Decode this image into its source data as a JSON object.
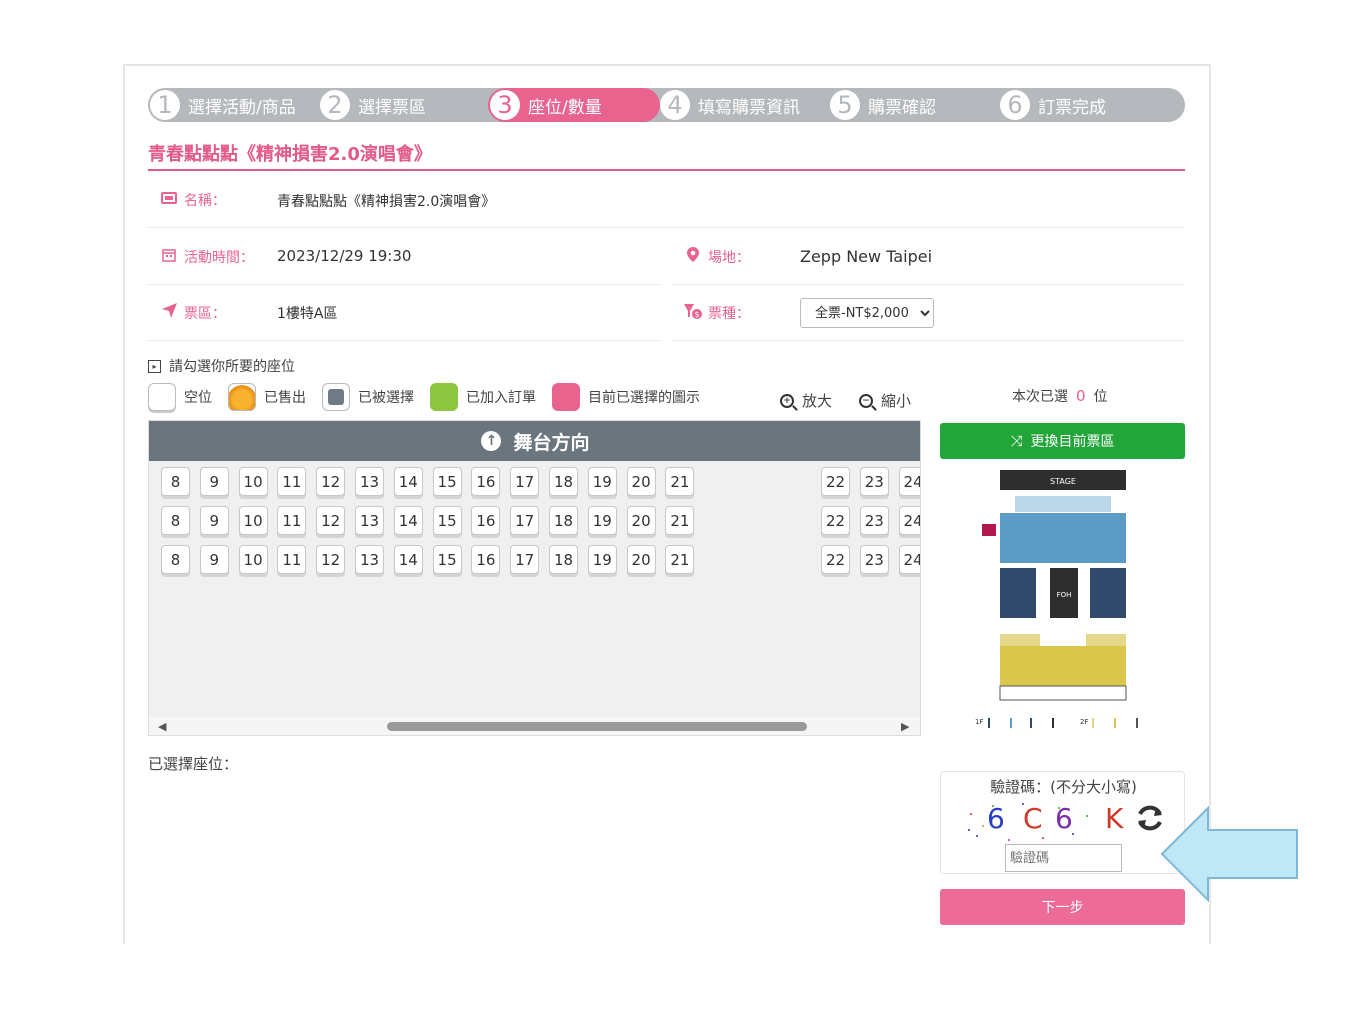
{
  "steps": [
    {
      "num": "1",
      "label": "選擇活動/商品"
    },
    {
      "num": "2",
      "label": "選擇票區"
    },
    {
      "num": "3",
      "label": "座位/數量"
    },
    {
      "num": "4",
      "label": "填寫購票資訊"
    },
    {
      "num": "5",
      "label": "購票確認"
    },
    {
      "num": "6",
      "label": "訂票完成"
    }
  ],
  "event_title": "青春點點點《精神損害2.0演唱會》",
  "info": {
    "name_label": "名稱：",
    "name_value": "青春點點點《精神損害2.0演唱會》",
    "time_label": "活動時間：",
    "time_value": "2023/12/29  19:30",
    "venue_label": "場地：",
    "venue_value": "Zepp  New  Taipei",
    "area_label": "票區：",
    "area_value": "1樓特A區",
    "type_label": "票種：",
    "type_value": "全票-NT$2,000"
  },
  "choose_hint": "請勾選你所要的座位",
  "legend": [
    {
      "label": "空位",
      "color": "#ffffff"
    },
    {
      "label": "已售出",
      "color": "#f0a020"
    },
    {
      "label": "已被選擇",
      "color": "#6f7a85"
    },
    {
      "label": "已加入訂單",
      "color": "#8cc63f"
    },
    {
      "label": "目前已選擇的圖示",
      "color": "#e8648f"
    }
  ],
  "zoom_in": "放大",
  "zoom_out": "縮小",
  "selected_count": {
    "prefix": "本次已選",
    "count": "0",
    "suffix": "位"
  },
  "stage_direction": "舞台方向",
  "seat_rows": [
    [
      "8",
      "9",
      "10",
      "11",
      "12",
      "13",
      "14",
      "15",
      "16",
      "17",
      "18",
      "19",
      "20",
      "21",
      "22",
      "23",
      "24"
    ],
    [
      "8",
      "9",
      "10",
      "11",
      "12",
      "13",
      "14",
      "15",
      "16",
      "17",
      "18",
      "19",
      "20",
      "21",
      "22",
      "23",
      "24"
    ],
    [
      "8",
      "9",
      "10",
      "11",
      "12",
      "13",
      "14",
      "15",
      "16",
      "17",
      "18",
      "19",
      "20",
      "21",
      "22",
      "23",
      "24"
    ]
  ],
  "switch_area_button": "更換目前票區",
  "venue_map": {
    "stage": "STAGE",
    "foh": "FOH",
    "floor1": "1F",
    "floor2": "2F"
  },
  "selected_seats_label": "已選擇座位：",
  "captcha": {
    "label": "驗證碼：(不分大小寫)",
    "chars": [
      "6",
      "C",
      "6",
      "K"
    ],
    "placeholder": "驗證碼"
  },
  "next_button": "下一步",
  "colors": {
    "accent": "#e8648f",
    "green": "#22a63a",
    "step_gray": "#b5b8bc",
    "arrow_blue": "#bfe8f7"
  }
}
